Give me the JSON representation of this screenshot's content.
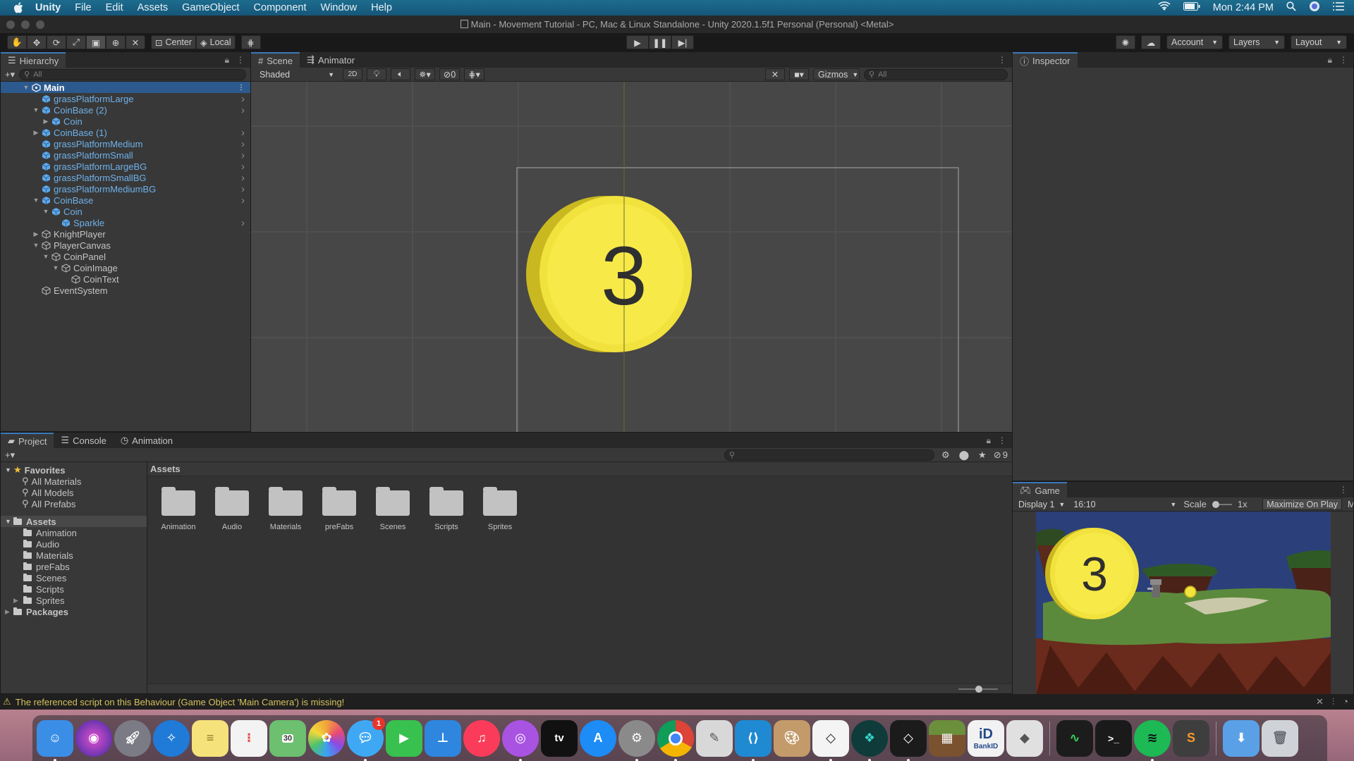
{
  "menubar": {
    "app": "Unity",
    "items": [
      "File",
      "Edit",
      "Assets",
      "GameObject",
      "Component",
      "Window",
      "Help"
    ],
    "clock": "Mon 2:44 PM"
  },
  "window": {
    "title": "Main - Movement Tutorial - PC, Mac & Linux Standalone - Unity 2020.1.5f1 Personal (Personal) <Metal>"
  },
  "toolbar": {
    "pivot": "Center",
    "space": "Local",
    "account": "Account",
    "layers": "Layers",
    "layout": "Layout"
  },
  "hierarchy": {
    "tab": "Hierarchy",
    "search_placeholder": "All",
    "scene_name": "Main",
    "items": [
      {
        "label": "grassPlatformLarge",
        "depth": 1,
        "prefab": true,
        "expand": "",
        "chevron": true
      },
      {
        "label": "CoinBase (2)",
        "depth": 1,
        "prefab": true,
        "expand": "open",
        "chevron": true
      },
      {
        "label": "Coin",
        "depth": 2,
        "prefab": true,
        "expand": "closed",
        "chevron": false
      },
      {
        "label": "CoinBase (1)",
        "depth": 1,
        "prefab": true,
        "expand": "closed",
        "chevron": true
      },
      {
        "label": "grassPlatformMedium",
        "depth": 1,
        "prefab": true,
        "expand": "",
        "chevron": true
      },
      {
        "label": "grassPlatformSmall",
        "depth": 1,
        "prefab": true,
        "expand": "",
        "chevron": true
      },
      {
        "label": "grassPlatformLargeBG",
        "depth": 1,
        "prefab": true,
        "expand": "",
        "chevron": true
      },
      {
        "label": "grassPlatformSmallBG",
        "depth": 1,
        "prefab": true,
        "expand": "",
        "chevron": true
      },
      {
        "label": "grassPlatformMediumBG",
        "depth": 1,
        "prefab": true,
        "expand": "",
        "chevron": true
      },
      {
        "label": "CoinBase",
        "depth": 1,
        "prefab": true,
        "expand": "open",
        "chevron": true
      },
      {
        "label": "Coin",
        "depth": 2,
        "prefab": true,
        "expand": "open",
        "chevron": false
      },
      {
        "label": "Sparkle",
        "depth": 3,
        "prefab": true,
        "expand": "",
        "chevron": true
      },
      {
        "label": "KnightPlayer",
        "depth": 1,
        "prefab": false,
        "expand": "closed",
        "chevron": false
      },
      {
        "label": "PlayerCanvas",
        "depth": 1,
        "prefab": false,
        "expand": "open",
        "chevron": false
      },
      {
        "label": "CoinPanel",
        "depth": 2,
        "prefab": false,
        "expand": "open",
        "chevron": false
      },
      {
        "label": "CoinImage",
        "depth": 3,
        "prefab": false,
        "expand": "open",
        "chevron": false
      },
      {
        "label": "CoinText",
        "depth": 4,
        "prefab": false,
        "expand": "",
        "chevron": false
      },
      {
        "label": "EventSystem",
        "depth": 1,
        "prefab": false,
        "expand": "",
        "chevron": false
      }
    ]
  },
  "scene": {
    "tabs": [
      "Scene",
      "Animator"
    ],
    "draw_mode": "Shaded",
    "mode_2d": "2D",
    "hidden_count": "0",
    "gizmos": "Gizmos",
    "search_placeholder": "All",
    "coin_text": "3"
  },
  "inspector": {
    "tab": "Inspector"
  },
  "project": {
    "tabs": [
      "Project",
      "Console",
      "Animation"
    ],
    "hidden_count": "9",
    "favorites_label": "Favorites",
    "favorites": [
      "All Materials",
      "All Models",
      "All Prefabs"
    ],
    "assets_label": "Assets",
    "asset_folders": [
      "Animation",
      "Audio",
      "Materials",
      "preFabs",
      "Scenes",
      "Scripts",
      "Sprites"
    ],
    "packages_label": "Packages",
    "breadcrumb": "Assets",
    "grid_items": [
      "Animation",
      "Audio",
      "Materials",
      "preFabs",
      "Scenes",
      "Scripts",
      "Sprites"
    ]
  },
  "game": {
    "tab": "Game",
    "display": "Display 1",
    "aspect": "16:10",
    "scale_label": "Scale",
    "scale_value": "1x",
    "maximize": "Maximize On Play",
    "overflow_letter": "M",
    "coin_text": "3"
  },
  "status": {
    "message": "The referenced script on this Behaviour (Game Object 'Main Camera') is missing!"
  },
  "dock": {
    "messages_badge": "1",
    "calendar_day": "30",
    "tv_label": "tv",
    "bankid_label": "BankID",
    "colors": {
      "finder": "#3a8ee6",
      "siri": "#7a3fd1",
      "launchpad": "#7b7b86",
      "safari": "#1f7ad8",
      "notes": "#f6e27a",
      "reminders": "#f3f3f3",
      "maps": "#6cc070",
      "photos": "#f2a43a",
      "messages": "#3fa8f5",
      "facetime": "#38c14e",
      "keynote": "#2e86de",
      "music": "#fa3c5a",
      "podcasts": "#a953e2",
      "tv": "#111111",
      "appstore": "#1d8cf5",
      "settings": "#8a8a8a",
      "chrome": "#e8e8e8",
      "preview": "#d8d8d8",
      "vscode": "#1f8ad2",
      "paint": "#c39a6a",
      "unity": "#f4f4f4",
      "gitkraken": "#0f3b3a",
      "unityhub": "#1b1b1b",
      "minecraft": "#6b8f3a",
      "bankid": "#f2f2f2",
      "roblox": "#e0e0e0",
      "activity": "#1c1c1c",
      "terminal": "#1a1a1a",
      "spotify": "#1db954",
      "sublime": "#3e3e3e",
      "downloads": "#5aa0e6",
      "trash": "#cfd3d8"
    }
  }
}
